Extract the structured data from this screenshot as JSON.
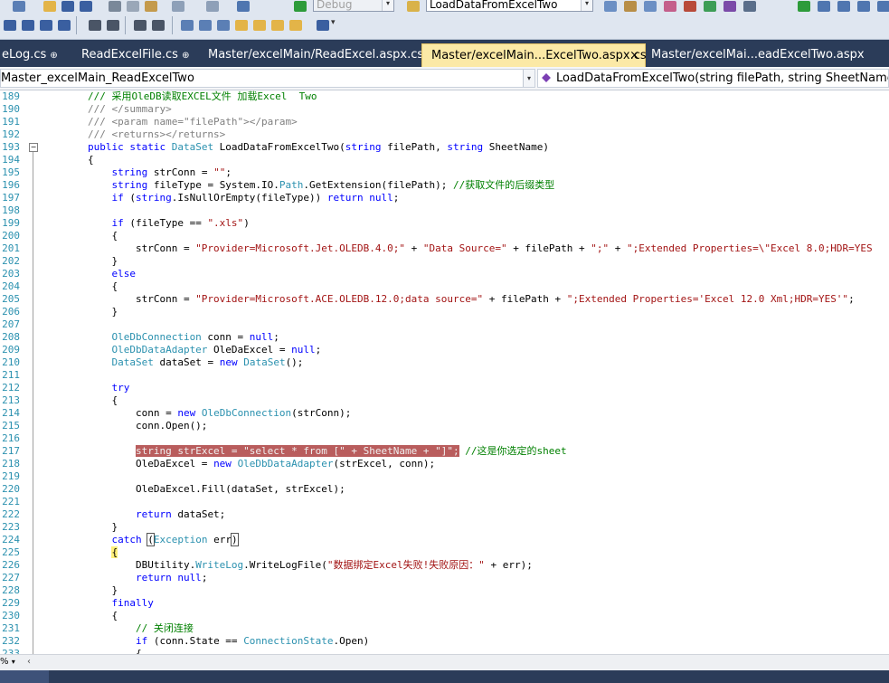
{
  "toolbar": {
    "config_combo": "Debug",
    "find_combo": "LoadDataFromExcelTwo"
  },
  "tabs": [
    {
      "label": "eLog.cs",
      "pinned": true,
      "active": false
    },
    {
      "label": "ReadExcelFile.cs",
      "pinned": true,
      "active": false
    },
    {
      "label": "Master/excelMain/ReadExcel.aspx.cs",
      "pinned": false,
      "active": false
    },
    {
      "label": "Master/excelMain...ExcelTwo.aspx.cs",
      "pinned": false,
      "active": true,
      "close": "×"
    },
    {
      "label": "Master/excelMai...eadExcelTwo.aspx",
      "pinned": false,
      "active": false
    }
  ],
  "nav": {
    "type_combo": "Master_excelMain_ReadExcelTwo",
    "member_combo": "LoadDataFromExcelTwo(string filePath, string SheetName)"
  },
  "editor": {
    "lines": [
      {
        "n": "189",
        "parts": [
          [
            "c",
            "        /// 采用OleDB读取EXCEL文件 加载Excel  Two"
          ]
        ]
      },
      {
        "n": "190",
        "parts": [
          [
            "d",
            "        /// </summary>"
          ]
        ]
      },
      {
        "n": "191",
        "parts": [
          [
            "d",
            "        /// <param name=\"filePath\"></param>"
          ]
        ]
      },
      {
        "n": "192",
        "parts": [
          [
            "d",
            "        /// <returns></returns>"
          ]
        ]
      },
      {
        "n": "193",
        "parts": [
          [
            "k",
            "        public static "
          ],
          [
            "t",
            "DataSet"
          ],
          [
            "",
            " LoadDataFromExcelTwo("
          ],
          [
            "k",
            "string"
          ],
          [
            "",
            " filePath, "
          ],
          [
            "k",
            "string"
          ],
          [
            "",
            " SheetName)"
          ]
        ]
      },
      {
        "n": "194",
        "parts": [
          [
            "",
            "        {"
          ]
        ]
      },
      {
        "n": "195",
        "parts": [
          [
            "k",
            "            string"
          ],
          [
            "",
            " strConn = "
          ],
          [
            "s",
            "\"\""
          ],
          [
            "",
            ";"
          ]
        ]
      },
      {
        "n": "196",
        "parts": [
          [
            "k",
            "            string"
          ],
          [
            "",
            " fileType = System.IO."
          ],
          [
            "t",
            "Path"
          ],
          [
            "",
            ".GetExtension(filePath); "
          ],
          [
            "c",
            "//获取文件的后缀类型"
          ]
        ]
      },
      {
        "n": "197",
        "parts": [
          [
            "k",
            "            if"
          ],
          [
            "",
            " ("
          ],
          [
            "k",
            "string"
          ],
          [
            "",
            ".IsNullOrEmpty(fileType)) "
          ],
          [
            "k",
            "return null"
          ],
          [
            "",
            ";"
          ]
        ]
      },
      {
        "n": "198",
        "parts": [
          [
            "",
            ""
          ]
        ]
      },
      {
        "n": "199",
        "parts": [
          [
            "k",
            "            if"
          ],
          [
            "",
            " (fileType == "
          ],
          [
            "s",
            "\".xls\""
          ],
          [
            "",
            ")"
          ]
        ]
      },
      {
        "n": "200",
        "parts": [
          [
            "",
            "            {"
          ]
        ]
      },
      {
        "n": "201",
        "parts": [
          [
            "",
            "                strConn = "
          ],
          [
            "s",
            "\"Provider=Microsoft.Jet.OLEDB.4.0;\""
          ],
          [
            "",
            " + "
          ],
          [
            "s",
            "\"Data Source=\""
          ],
          [
            "",
            " + filePath + "
          ],
          [
            "s",
            "\";\""
          ],
          [
            "",
            " + "
          ],
          [
            "s",
            "\";Extended Properties=\\\"Excel 8.0;HDR=YES"
          ]
        ]
      },
      {
        "n": "202",
        "parts": [
          [
            "",
            "            }"
          ]
        ]
      },
      {
        "n": "203",
        "parts": [
          [
            "k",
            "            else"
          ]
        ]
      },
      {
        "n": "204",
        "parts": [
          [
            "",
            "            {"
          ]
        ]
      },
      {
        "n": "205",
        "parts": [
          [
            "",
            "                strConn = "
          ],
          [
            "s",
            "\"Provider=Microsoft.ACE.OLEDB.12.0;data source=\""
          ],
          [
            "",
            " + filePath + "
          ],
          [
            "s",
            "\";Extended Properties='Excel 12.0 Xml;HDR=YES'\""
          ],
          [
            "",
            ";"
          ]
        ]
      },
      {
        "n": "206",
        "parts": [
          [
            "",
            "            }"
          ]
        ]
      },
      {
        "n": "207",
        "parts": [
          [
            "",
            ""
          ]
        ]
      },
      {
        "n": "208",
        "parts": [
          [
            "t",
            "            OleDbConnection"
          ],
          [
            "",
            " conn = "
          ],
          [
            "k",
            "null"
          ],
          [
            "",
            ";"
          ]
        ]
      },
      {
        "n": "209",
        "parts": [
          [
            "t",
            "            OleDbDataAdapter"
          ],
          [
            "",
            " OleDaExcel = "
          ],
          [
            "k",
            "null"
          ],
          [
            "",
            ";"
          ]
        ]
      },
      {
        "n": "210",
        "parts": [
          [
            "t",
            "            DataSet"
          ],
          [
            "",
            " dataSet = "
          ],
          [
            "k",
            "new "
          ],
          [
            "t",
            "DataSet"
          ],
          [
            "",
            "();"
          ]
        ]
      },
      {
        "n": "211",
        "parts": [
          [
            "",
            ""
          ]
        ]
      },
      {
        "n": "212",
        "parts": [
          [
            "k",
            "            try"
          ]
        ]
      },
      {
        "n": "213",
        "parts": [
          [
            "",
            "            {"
          ]
        ]
      },
      {
        "n": "214",
        "parts": [
          [
            "",
            "                conn = "
          ],
          [
            "k",
            "new "
          ],
          [
            "t",
            "OleDbConnection"
          ],
          [
            "",
            "(strConn);"
          ]
        ]
      },
      {
        "n": "215",
        "parts": [
          [
            "",
            "                conn.Open();"
          ]
        ]
      },
      {
        "n": "216",
        "parts": [
          [
            "",
            ""
          ]
        ]
      },
      {
        "n": "217",
        "parts": [
          [
            "",
            "                "
          ],
          [
            "hl",
            "string strExcel = \"select * from [\" + SheetName + \"]\";"
          ],
          [
            "",
            " "
          ],
          [
            "c",
            "//这是你选定的sheet"
          ]
        ]
      },
      {
        "n": "218",
        "parts": [
          [
            "",
            "                OleDaExcel = "
          ],
          [
            "k",
            "new "
          ],
          [
            "t",
            "OleDbDataAdapter"
          ],
          [
            "",
            "(strExcel, conn);"
          ]
        ]
      },
      {
        "n": "219",
        "parts": [
          [
            "",
            ""
          ]
        ]
      },
      {
        "n": "220",
        "parts": [
          [
            "",
            "                OleDaExcel.Fill(dataSet, strExcel);"
          ]
        ]
      },
      {
        "n": "221",
        "parts": [
          [
            "",
            ""
          ]
        ]
      },
      {
        "n": "222",
        "parts": [
          [
            "k",
            "                return"
          ],
          [
            "",
            " dataSet;"
          ]
        ]
      },
      {
        "n": "223",
        "parts": [
          [
            "",
            "            }"
          ]
        ]
      },
      {
        "n": "224",
        "parts": [
          [
            "k",
            "            catch"
          ],
          [
            "",
            " "
          ],
          [
            "box",
            "("
          ],
          [
            "t",
            "Exception"
          ],
          [
            "",
            " err"
          ],
          [
            "box",
            ")"
          ]
        ]
      },
      {
        "n": "225",
        "parts": [
          [
            "",
            "            "
          ],
          [
            "brace",
            "{"
          ]
        ]
      },
      {
        "n": "226",
        "parts": [
          [
            "",
            "                DBUtility."
          ],
          [
            "t",
            "WriteLog"
          ],
          [
            "",
            ".WriteLogFile("
          ],
          [
            "s",
            "\"数据绑定Excel失败!失败原因：\""
          ],
          [
            "",
            " + err);"
          ]
        ]
      },
      {
        "n": "227",
        "parts": [
          [
            "k",
            "                return null"
          ],
          [
            "",
            ";"
          ]
        ]
      },
      {
        "n": "228",
        "parts": [
          [
            "",
            "            }"
          ]
        ]
      },
      {
        "n": "229",
        "parts": [
          [
            "k",
            "            finally"
          ]
        ]
      },
      {
        "n": "230",
        "parts": [
          [
            "",
            "            {"
          ]
        ]
      },
      {
        "n": "231",
        "parts": [
          [
            "c",
            "                // 关闭连接"
          ]
        ]
      },
      {
        "n": "232",
        "parts": [
          [
            "k",
            "                if"
          ],
          [
            "",
            " (conn.State == "
          ],
          [
            "t",
            "ConnectionState"
          ],
          [
            "",
            ".Open)"
          ]
        ]
      },
      {
        "n": "233",
        "parts": [
          [
            "",
            "                {"
          ]
        ]
      }
    ]
  },
  "bottom": {
    "zoom": "%"
  },
  "colors": {
    "tabstrip": "#2b3c59",
    "active_tab": "#fbe9a6",
    "keyword": "#0000ff",
    "type": "#2b91af",
    "string": "#a31515",
    "comment": "#008000",
    "selection": "#b95d5d"
  },
  "icons": [
    "table-icon",
    "open-icon",
    "save-icon",
    "save-all-icon",
    "cut-icon",
    "copy-icon",
    "paste-icon",
    "undo-icon",
    "redo-icon",
    "navigate-back-icon",
    "start-debug-icon",
    "find-in-files-icon",
    "method-icon",
    "collapse-icon"
  ]
}
